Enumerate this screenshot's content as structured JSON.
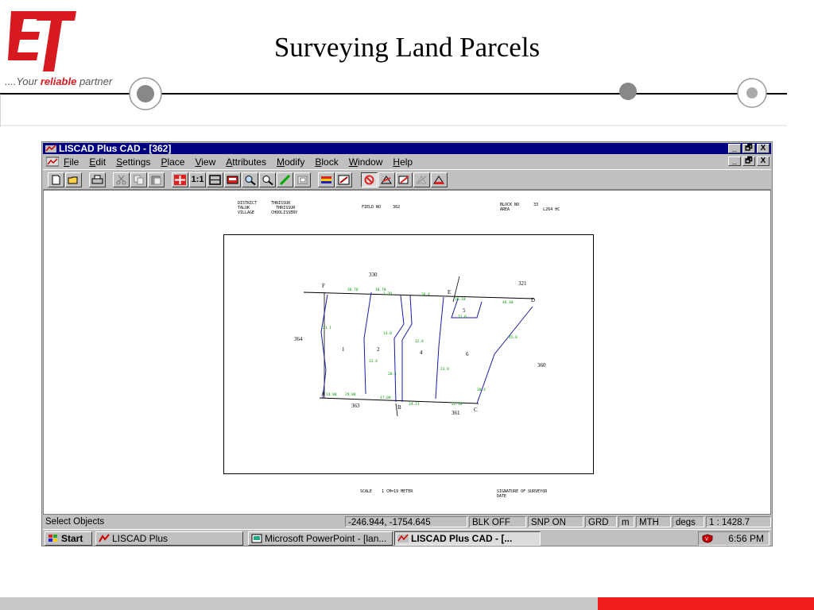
{
  "slide": {
    "title": "Surveying Land Parcels",
    "logo_text": "ET",
    "tagline_prefix": "....Your ",
    "tagline_emph": "reliable",
    "tagline_suffix": " partner"
  },
  "colors": {
    "brand_red": "#d71a20",
    "title_bar": "#000080",
    "footer_grey": "#c8c8c8",
    "footer_red": "#ee1c1c",
    "dimension_green": "#009900",
    "parcel_blue": "#1a1aa8"
  },
  "window": {
    "title": "LISCAD Plus CAD - [362]",
    "controls": [
      "_",
      "🗗",
      "X"
    ],
    "menu": [
      {
        "label": "File"
      },
      {
        "label": "Edit"
      },
      {
        "label": "Settings"
      },
      {
        "label": "Place"
      },
      {
        "label": "View"
      },
      {
        "label": "Attributes"
      },
      {
        "label": "Modify"
      },
      {
        "label": "Block"
      },
      {
        "label": "Window"
      },
      {
        "label": "Help"
      }
    ],
    "toolbar_icons": [
      "new-icon",
      "open-icon",
      "print-icon",
      "cut-icon",
      "copy-icon",
      "paste-icon",
      "pan-icon",
      "scale-1-1-icon",
      "fit-icon",
      "window-icon",
      "zoom-in-icon",
      "zoom-out-icon",
      "draw-icon",
      "layer-icon",
      "stack-icon",
      "edit-icon",
      "delete-icon",
      "tool-a-icon",
      "tool-b-icon",
      "tool-c-icon",
      "tool-d-icon"
    ],
    "scale_label": "1:1"
  },
  "plan": {
    "header_left": "DISTRICT      THRISSUR\nTALUK           THRISSUR\nVILLAGE       CHOOLISSERY",
    "header_mid": "FIELD NO     362",
    "header_right": "BLOCK NO      33\nAREA              L264 HC",
    "footer_left": "SCALE    1 CM=19 METER",
    "footer_right": "SIGNATURE OF SURVEYOR\nDATE",
    "neighbours": [
      "330",
      "321",
      "364",
      "360",
      "363",
      "361"
    ],
    "corners": [
      "F",
      "E",
      "D",
      "A",
      "B",
      "C"
    ],
    "parcels": [
      "1",
      "2",
      "4",
      "5",
      "6"
    ]
  },
  "status": {
    "prompt": "Select Objects",
    "coords": "-246.944, -1754.645",
    "blk": "BLK OFF",
    "snp": "SNP ON",
    "grd": "GRD",
    "unit": "m",
    "mth": "MTH",
    "angle": "degs",
    "scale": "1 : 1428.7"
  },
  "taskbar": {
    "start": "Start",
    "tasks": [
      "LISCAD Plus",
      "Microsoft PowerPoint - [lan...",
      "LISCAD Plus CAD - [..."
    ],
    "clock": "6:56 PM"
  }
}
